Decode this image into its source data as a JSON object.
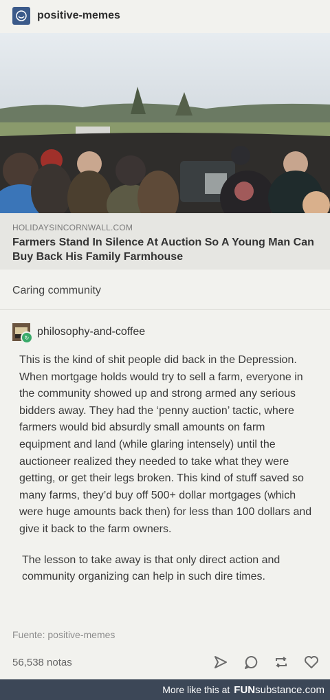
{
  "post": {
    "username": "positive-memes",
    "link": {
      "site": "HOLIDAYSINCORNWALL.COM",
      "title": "Farmers Stand In Silence At Auction So A Young Man Can Buy Back His Family Farmhouse"
    },
    "caption": "Caring community"
  },
  "reblog": {
    "username": "philosophy-and-coffee",
    "paragraph1": "This is the kind of shit people did back in the Depression. When mortgage holds would try to sell a farm, everyone in the community showed up and strong armed any serious bidders away. They had the ‘penny auction’ tactic, where farmers would bid absurdly small amounts on farm equipment and land (while glaring intensely) until the auctioneer realized they needed to take what they were getting, or get their legs broken. This kind of stuff saved so many farms, they’d buy off 500+ dollar mortgages (which were huge amounts back then) for less than 100 dollars and give it back to the farm owners.",
    "paragraph2": "The lesson to take away is that only direct action and community organizing can help in such dire times."
  },
  "source": "Fuente: positive-memes",
  "notes": "56,538 notas",
  "actions": [
    "share-icon",
    "reply-icon",
    "reblog-icon",
    "like-icon"
  ],
  "footer": {
    "more": "More like this at",
    "brand_prefix": "FUN",
    "brand_suffix": "substance.com"
  }
}
